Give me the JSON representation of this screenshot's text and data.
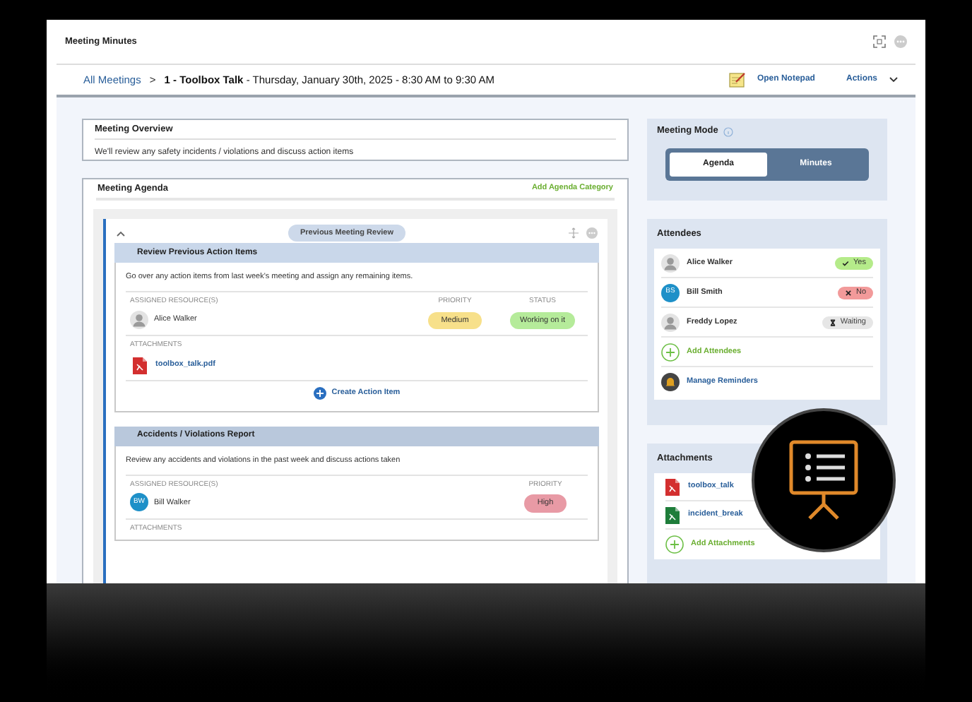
{
  "window": {
    "title": "Meeting Minutes"
  },
  "breadcrumb": {
    "link": "All Meetings",
    "separator": ">",
    "meeting": "1 - Toolbox Talk",
    "detail": "- Thursday, January 30th, 2025 - 8:30 AM to 9:30 AM"
  },
  "toolbar": {
    "notepad": "Open Notepad",
    "actions": "Actions"
  },
  "overview": {
    "title": "Meeting Overview",
    "text": "We'll review any safety incidents / violations and discuss action items"
  },
  "agenda": {
    "title": "Meeting Agenda",
    "add_label": "Add Agenda Category",
    "category": {
      "label": "Previous Meeting Review",
      "expanded": true,
      "items": [
        {
          "title": "Review Previous Action Items",
          "description": "Go over any action items from last week's meeting and assign any remaining items.",
          "resources_label": "ASSIGNED RESOURCE(S)",
          "resource": {
            "name": "Alice Walker"
          },
          "priority_label": "PRIORITY",
          "priority": {
            "text": "Medium",
            "color": "#f7e08a"
          },
          "status_label": "STATUS",
          "status": {
            "text": "Working on it",
            "color": "#b5eb9a"
          },
          "attachments_label": "ATTACHMENTS",
          "attachments": [
            "toolbox_talk.pdf"
          ],
          "create_label": "Create Action Item"
        },
        {
          "title": "Accidents / Violations Report",
          "description": "Review any accidents and violations in the past week and discuss actions taken",
          "resources_label": "ASSIGNED RESOURCE(S)",
          "resource": {
            "name": "Bill Walker",
            "initials": "BW"
          },
          "priority_label": "PRIORITY",
          "priority": {
            "text": "High",
            "color": "#e89aa5"
          },
          "attachments_label": "ATTACHMENTS"
        }
      ]
    }
  },
  "meeting_mode": {
    "title": "Meeting Mode",
    "options": [
      {
        "label": "Agenda",
        "selected": true
      },
      {
        "label": "Minutes",
        "selected": false
      }
    ]
  },
  "attendees": {
    "title": "Attendees",
    "list": [
      {
        "name": "Alice Walker",
        "response": {
          "kind": "yes",
          "label": "Yes"
        }
      },
      {
        "name": "Bill Smith",
        "initials": "BS",
        "response": {
          "kind": "no",
          "label": "No"
        }
      },
      {
        "name": "Freddy Lopez",
        "response": {
          "kind": "waiting",
          "label": "Waiting"
        }
      }
    ],
    "add_label": "Add Attendees",
    "reminders_label": "Manage Reminders"
  },
  "attachments": {
    "title": "Attachments",
    "files": [
      {
        "name": "toolbox_talk",
        "kind": "pdf"
      },
      {
        "name": "incident_break",
        "kind": "sheet"
      }
    ],
    "add_label": "Add Attachments"
  }
}
